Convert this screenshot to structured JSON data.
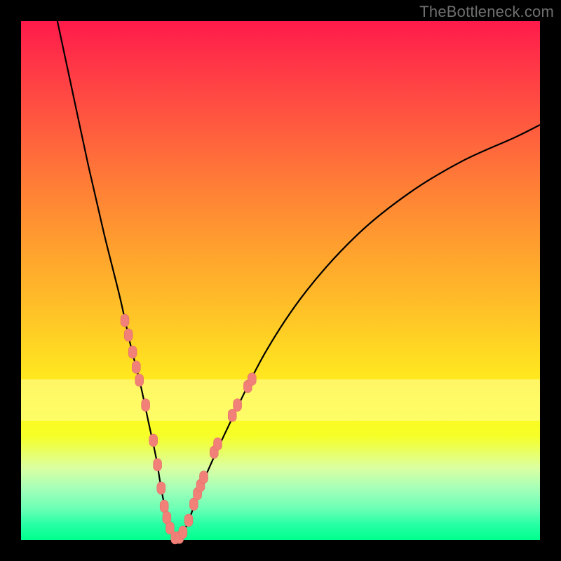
{
  "watermark": "TheBottleneck.com",
  "colors": {
    "frame": "#000000",
    "curve": "#000000",
    "marker_fill": "#f08078",
    "marker_stroke": "#e06a62",
    "highlight_band": "#ffffa0"
  },
  "chart_data": {
    "type": "line",
    "title": "",
    "xlabel": "",
    "ylabel": "",
    "xlim": [
      0,
      100
    ],
    "ylim": [
      0,
      100
    ],
    "curve": {
      "x": [
        7,
        10,
        13,
        16,
        19,
        21,
        23,
        24.5,
        26,
        27,
        28,
        29,
        30,
        32,
        35,
        40,
        47,
        55,
        65,
        75,
        85,
        95,
        100
      ],
      "y": [
        100,
        86,
        72,
        59,
        47,
        38,
        30,
        23,
        16,
        10,
        5,
        2,
        0,
        3,
        11,
        22,
        36,
        48,
        59,
        67,
        73,
        77.5,
        80
      ]
    },
    "highlight_band_y": [
      23,
      31
    ],
    "markers": [
      {
        "x": 20.0,
        "y": 42.3
      },
      {
        "x": 20.7,
        "y": 39.5
      },
      {
        "x": 21.5,
        "y": 36.2
      },
      {
        "x": 22.2,
        "y": 33.3
      },
      {
        "x": 22.8,
        "y": 30.8
      },
      {
        "x": 24.0,
        "y": 26.0
      },
      {
        "x": 25.5,
        "y": 19.2
      },
      {
        "x": 26.3,
        "y": 14.5
      },
      {
        "x": 27.0,
        "y": 10.0
      },
      {
        "x": 27.6,
        "y": 6.5
      },
      {
        "x": 28.1,
        "y": 4.3
      },
      {
        "x": 28.7,
        "y": 2.3
      },
      {
        "x": 29.7,
        "y": 0.4
      },
      {
        "x": 30.5,
        "y": 0.5
      },
      {
        "x": 31.2,
        "y": 1.5
      },
      {
        "x": 32.3,
        "y": 3.8
      },
      {
        "x": 33.3,
        "y": 6.9
      },
      {
        "x": 34.0,
        "y": 8.9
      },
      {
        "x": 34.6,
        "y": 10.5
      },
      {
        "x": 35.2,
        "y": 12.1
      },
      {
        "x": 37.2,
        "y": 16.9
      },
      {
        "x": 37.9,
        "y": 18.5
      },
      {
        "x": 40.7,
        "y": 24.0
      },
      {
        "x": 41.7,
        "y": 26.0
      },
      {
        "x": 43.7,
        "y": 29.6
      },
      {
        "x": 44.5,
        "y": 31.0
      }
    ]
  }
}
